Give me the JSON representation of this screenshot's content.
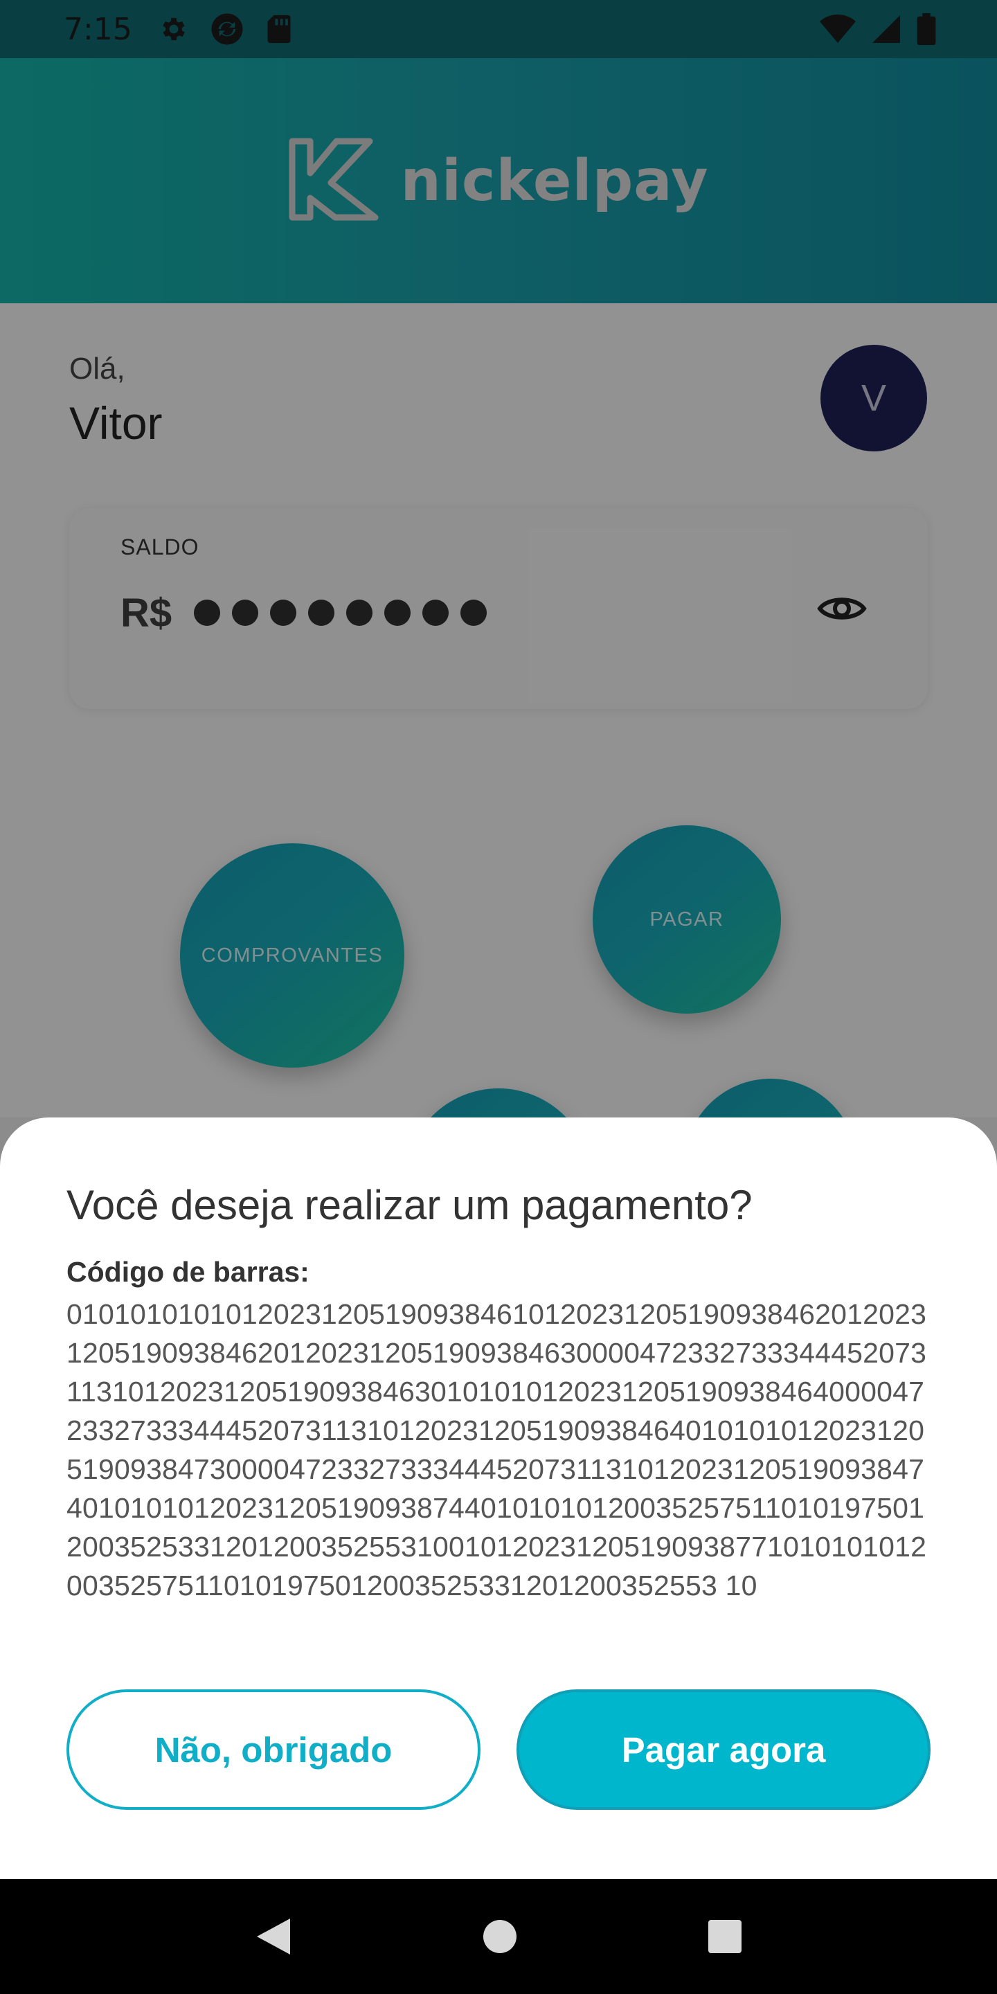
{
  "status_bar": {
    "time": "7:15",
    "left_icons": [
      "gear-icon",
      "sync-icon",
      "sd-card-icon"
    ],
    "right_icons": [
      "wifi-icon",
      "cellular-signal-icon",
      "battery-icon"
    ]
  },
  "header": {
    "logo_text": "nickelpay"
  },
  "main": {
    "greeting": "Olá,",
    "user_name": "Vitor",
    "avatar_initial": "V",
    "balance": {
      "label": "SALDO",
      "currency": "R$",
      "masked": true,
      "visibility_icon": "eye-icon"
    },
    "actions": {
      "receipts_label": "COMPROVANTES",
      "pay_label": "PAGAR"
    }
  },
  "sheet": {
    "title": "Você deseja realizar um pagamento?",
    "barcode_label": "Código de barras:",
    "barcode_value": "01010101010120231205190938461012023120519093846201202312051909384620120231205190938463000047233273334445207311310120231205190938463010101012023120519093846400004723327333444520731131012023120519093846401010101202312051909384730000472332733344452073113101202312051909384740101010120231205190938744010101012003525751101019750120035253312012003525531001012023120519093877101010101200352575110101975012003525331201200352553 10",
    "decline_label": "Não, obrigado",
    "confirm_label": "Pagar agora"
  },
  "colors": {
    "brand_teal": "#14b0a5",
    "accent_cyan": "#00b6cc",
    "avatar_bg": "#1f2156"
  }
}
